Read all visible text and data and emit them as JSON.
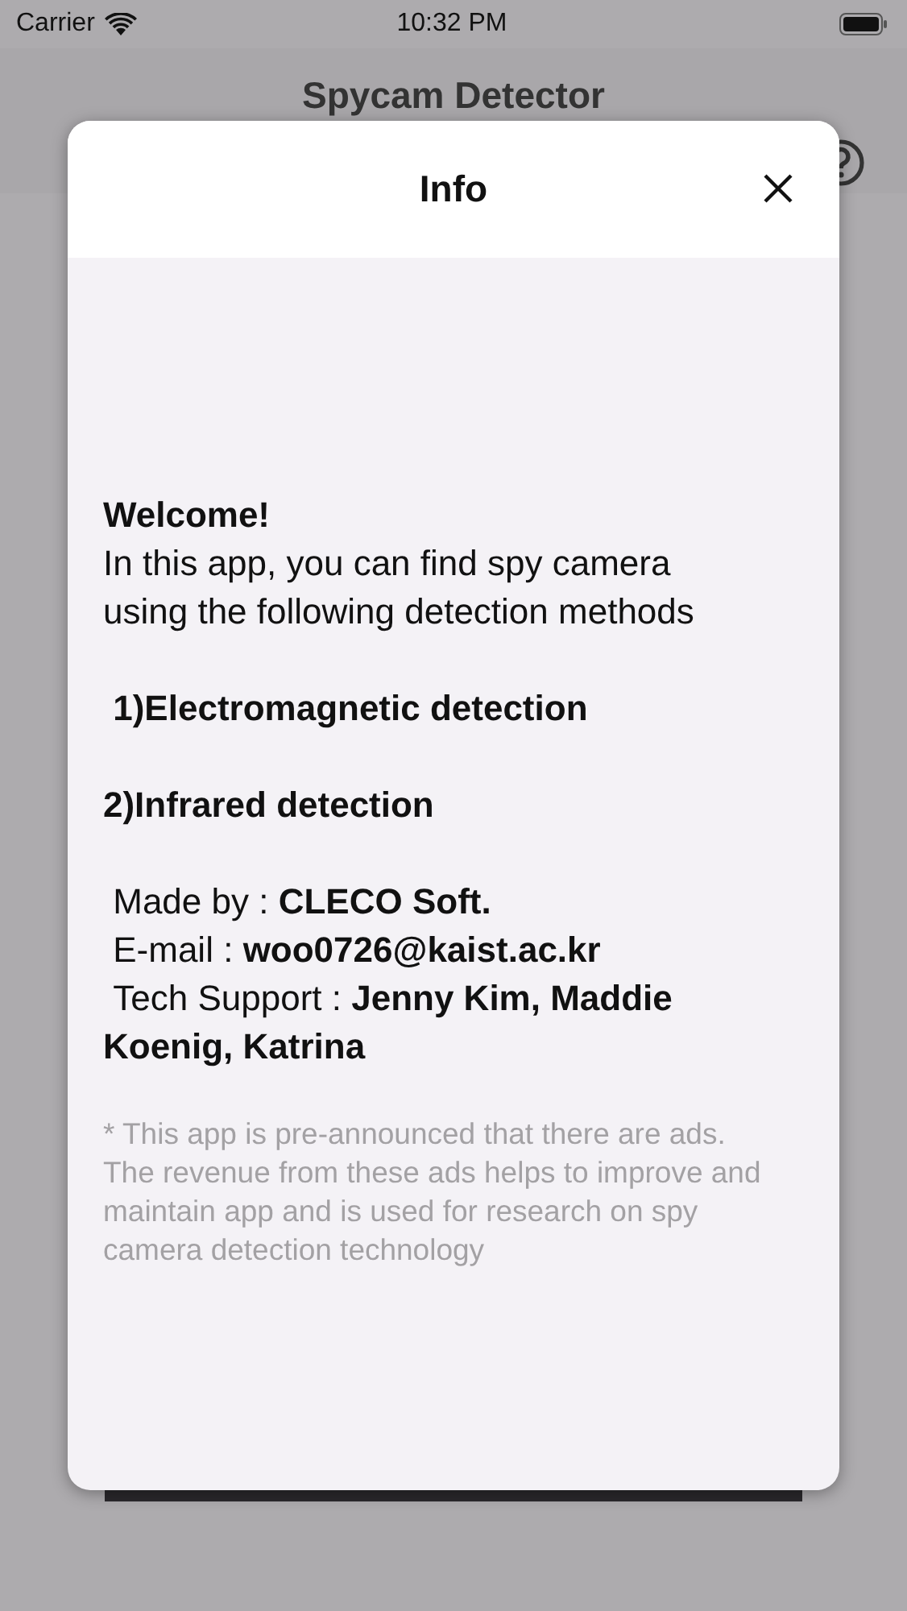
{
  "status_bar": {
    "carrier": "Carrier",
    "time": "10:32 PM"
  },
  "nav_bar": {
    "title": "Spycam Detector"
  },
  "dialog": {
    "title": "Info",
    "welcome": "Welcome!",
    "intro": "In this app, you can find spy camera using the following detection methods",
    "methods": [
      " 1)Electromagnetic detection",
      "2)Infrared detection"
    ],
    "credits": [
      " Made by : **CLECO Soft.**",
      " E-mail : **woo0726@kaist.ac.kr**",
      " Tech Support : **Jenny Kim, Maddie Koenig, Katrina**"
    ],
    "notice": "* This app is pre-announced that there are ads. The revenue from these ads helps to improve and maintain app and is used for research on spy camera detection technology"
  }
}
